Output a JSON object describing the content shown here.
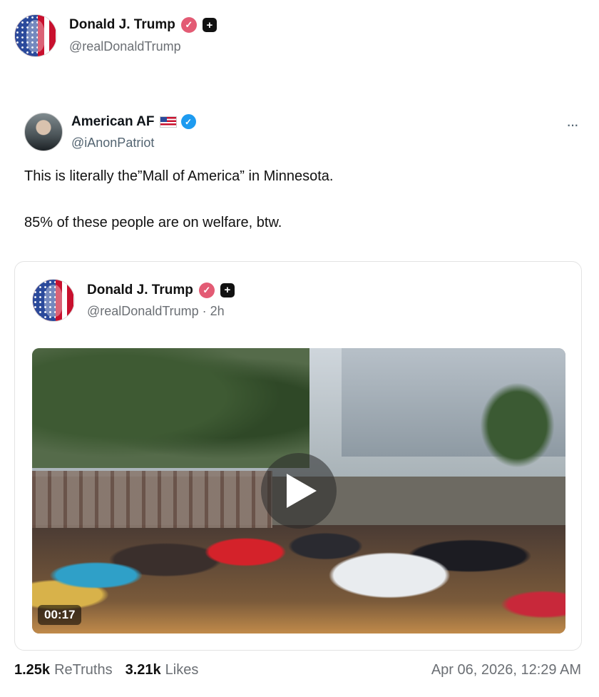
{
  "post": {
    "author_name": "Donald J. Trump",
    "author_handle": "@realDonaldTrump"
  },
  "embedded_post": {
    "author_name": "American AF",
    "author_handle": "@iAnonPatriot",
    "more_icon": "···",
    "text_line_1": "This is literally the”Mall of America” in Minnesota.",
    "text_line_2": "85% of these people are on welfare, btw."
  },
  "quoted_post": {
    "author_name": "Donald J. Trump",
    "author_handle_time": "@realDonaldTrump · 2h",
    "video": {
      "duration": "00:17"
    }
  },
  "footer": {
    "retruths_count": "1.25k",
    "retruths_label": "ReTruths",
    "likes_count": "3.21k",
    "likes_label": "Likes",
    "timestamp": "Apr 06, 2026, 12:29 AM"
  },
  "colors": {
    "verified_pink": "#e35b74",
    "verified_blue": "#1d9bf0",
    "muted_text": "#6b6f74"
  }
}
